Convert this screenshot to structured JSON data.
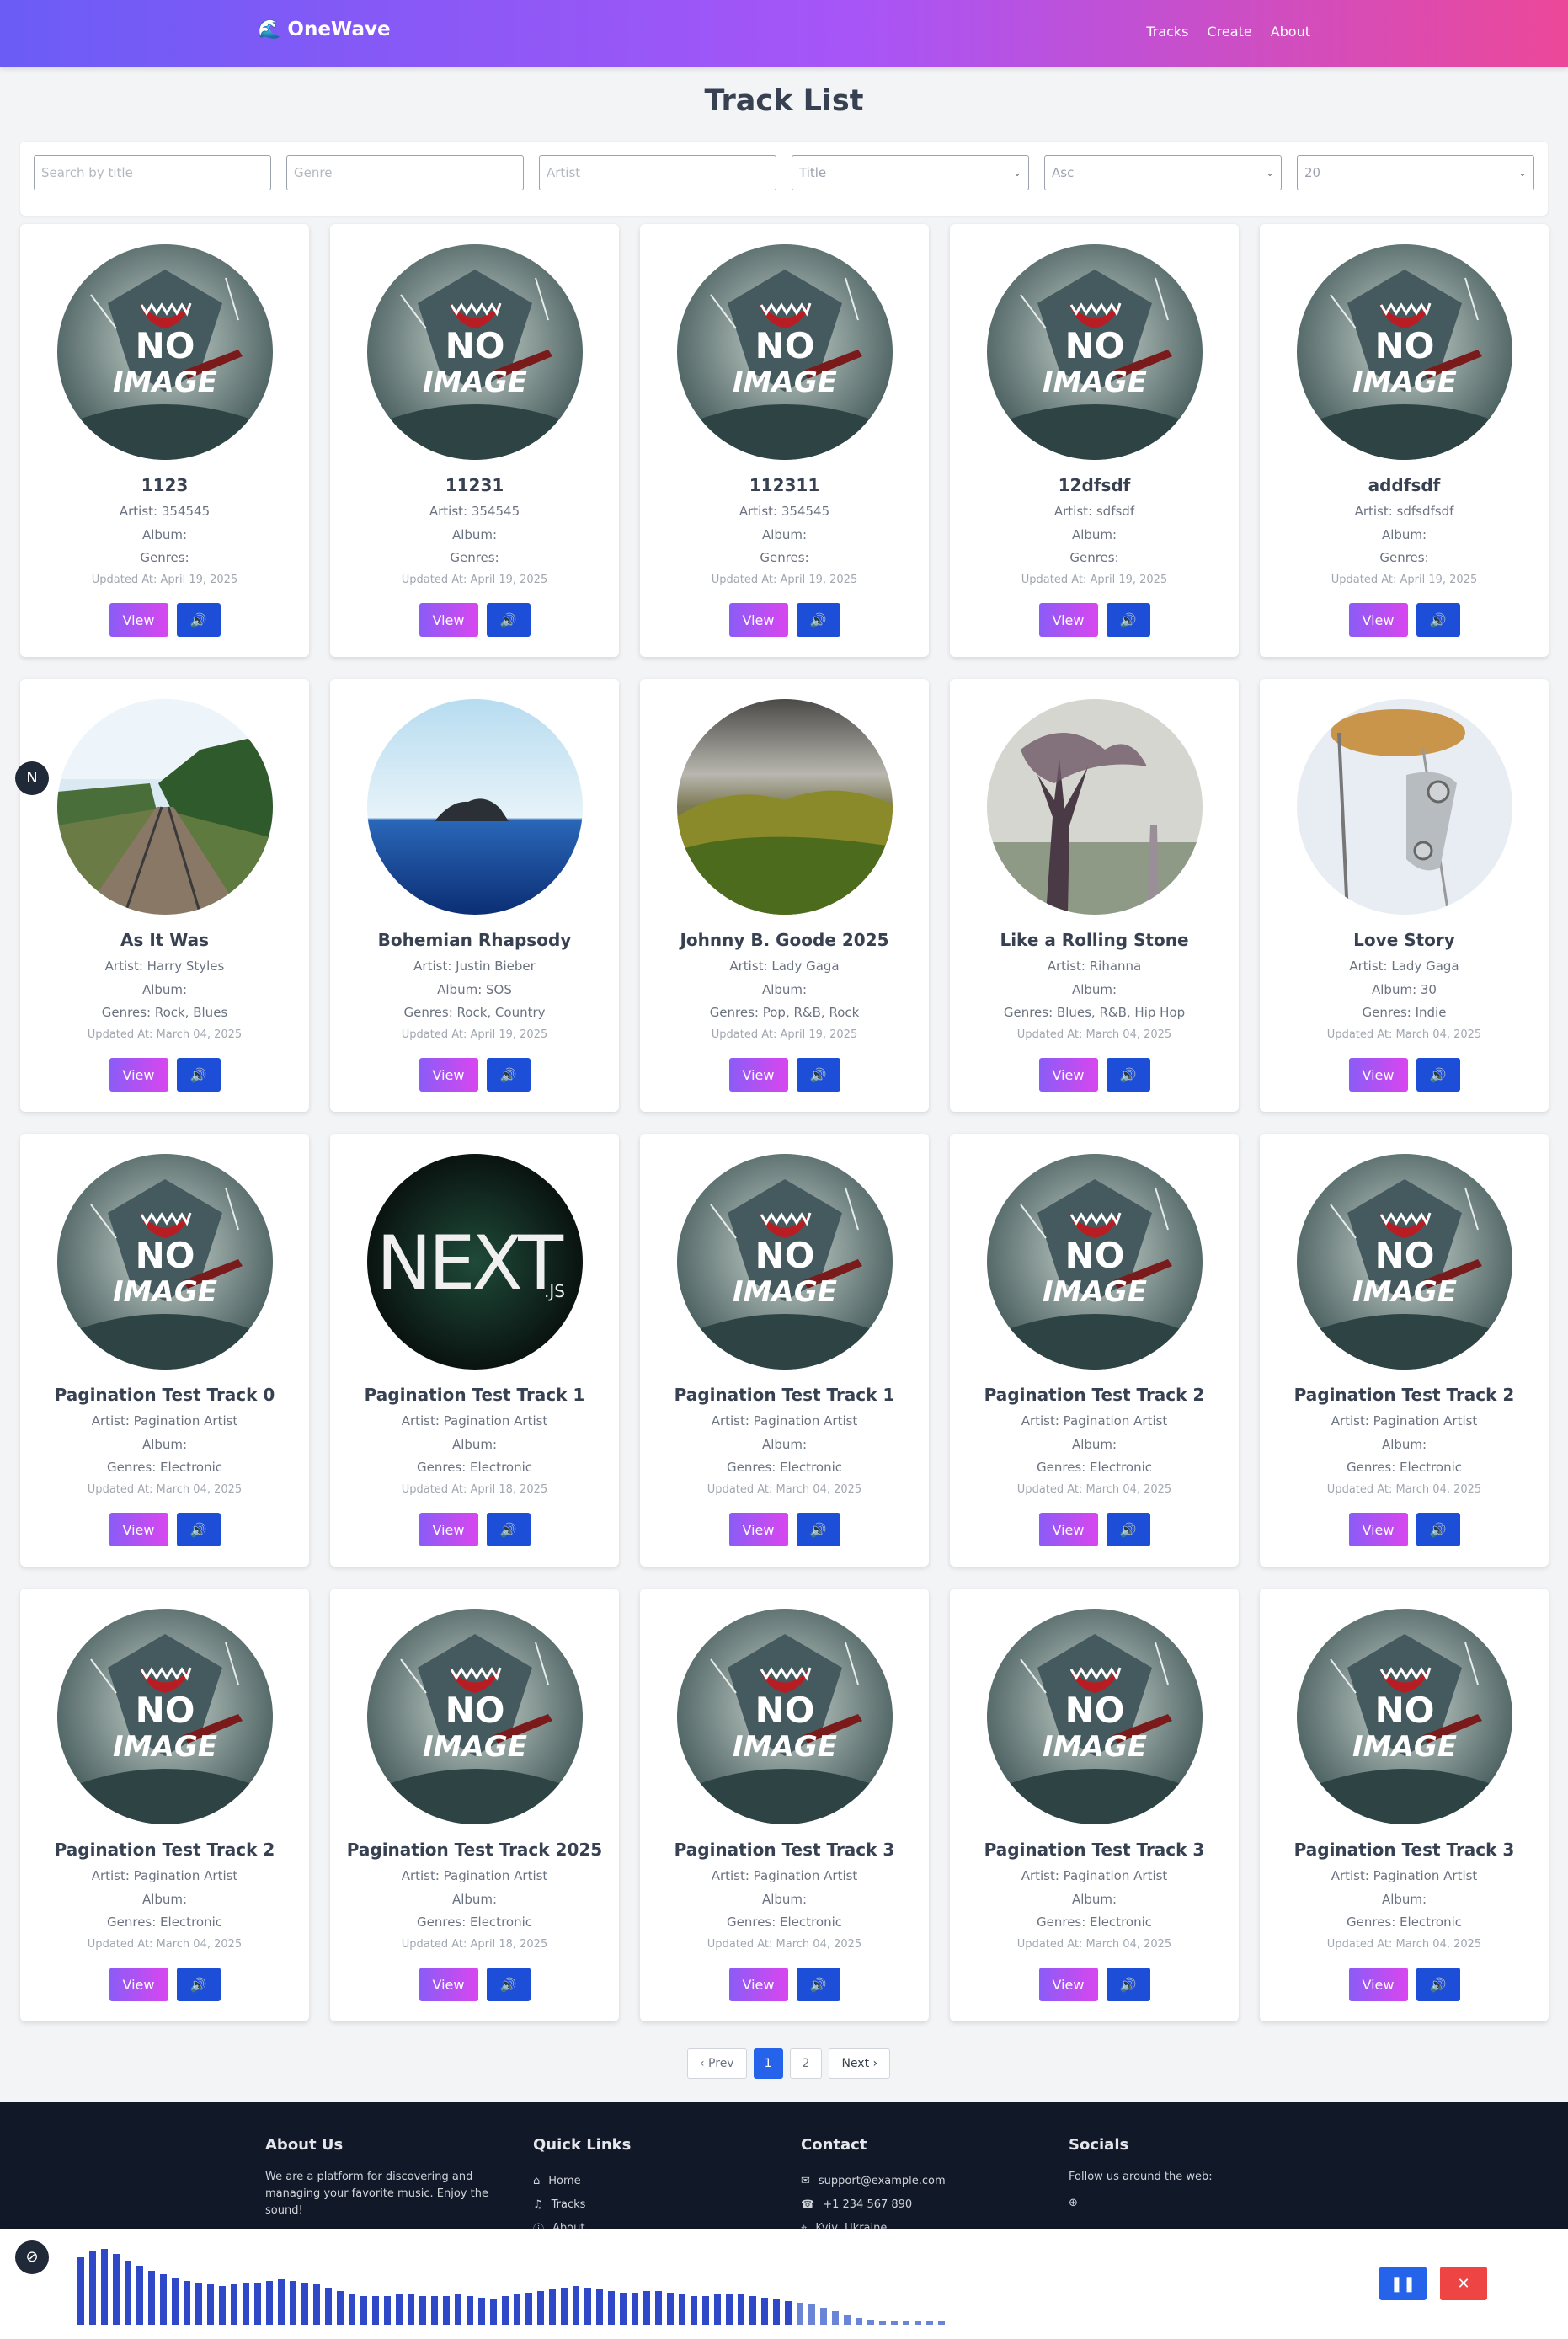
{
  "nav": {
    "brand": "OneWave",
    "links": [
      "Tracks",
      "Create",
      "About"
    ]
  },
  "page_title": "Track List",
  "filters": {
    "search_placeholder": "Search by title",
    "genre_placeholder": "Genre",
    "artist_placeholder": "Artist",
    "sort_value": "Title",
    "order_value": "Asc",
    "limit_value": "20"
  },
  "buttons": {
    "view": "View",
    "play_icon": "🔊"
  },
  "tracks": [
    {
      "title": "1123",
      "artist": "Artist: 354545",
      "album": "Album:",
      "genres": "Genres:",
      "updated": "Updated At: April 19, 2025",
      "cover": "no-image"
    },
    {
      "title": "11231",
      "artist": "Artist: 354545",
      "album": "Album:",
      "genres": "Genres:",
      "updated": "Updated At: April 19, 2025",
      "cover": "no-image"
    },
    {
      "title": "112311",
      "artist": "Artist: 354545",
      "album": "Album:",
      "genres": "Genres:",
      "updated": "Updated At: April 19, 2025",
      "cover": "no-image"
    },
    {
      "title": "12dfsdf",
      "artist": "Artist: sdfsdf",
      "album": "Album:",
      "genres": "Genres:",
      "updated": "Updated At: April 19, 2025",
      "cover": "no-image"
    },
    {
      "title": "addfsdf",
      "artist": "Artist: sdfsdfsdf",
      "album": "Album:",
      "genres": "Genres:",
      "updated": "Updated At: April 19, 2025",
      "cover": "no-image"
    },
    {
      "title": "As It Was",
      "artist": "Artist: Harry Styles",
      "album": "Album:",
      "genres": "Genres: Rock, Blues",
      "updated": "Updated At: March 04, 2025",
      "cover": "railway"
    },
    {
      "title": "Bohemian Rhapsody",
      "artist": "Artist: Justin Bieber",
      "album": "Album: SOS",
      "genres": "Genres: Rock, Country",
      "updated": "Updated At: April 19, 2025",
      "cover": "sea"
    },
    {
      "title": "Johnny B. Goode 2025",
      "artist": "Artist: Lady Gaga",
      "album": "Album:",
      "genres": "Genres: Pop, R&B, Rock",
      "updated": "Updated At: April 19, 2025",
      "cover": "hills"
    },
    {
      "title": "Like a Rolling Stone",
      "artist": "Artist: Rihanna",
      "album": "Album:",
      "genres": "Genres: Blues, R&B, Hip Hop",
      "updated": "Updated At: March 04, 2025",
      "cover": "fog-tree"
    },
    {
      "title": "Love Story",
      "artist": "Artist: Lady Gaga",
      "album": "Album: 30",
      "genres": "Genres: Indie",
      "updated": "Updated At: March 04, 2025",
      "cover": "drum"
    },
    {
      "title": "Pagination Test Track 0",
      "artist": "Artist: Pagination Artist",
      "album": "Album:",
      "genres": "Genres: Electronic",
      "updated": "Updated At: March 04, 2025",
      "cover": "no-image"
    },
    {
      "title": "Pagination Test Track 1",
      "artist": "Artist: Pagination Artist",
      "album": "Album:",
      "genres": "Genres: Electronic",
      "updated": "Updated At: April 18, 2025",
      "cover": "next"
    },
    {
      "title": "Pagination Test Track 1",
      "artist": "Artist: Pagination Artist",
      "album": "Album:",
      "genres": "Genres: Electronic",
      "updated": "Updated At: March 04, 2025",
      "cover": "no-image"
    },
    {
      "title": "Pagination Test Track 2",
      "artist": "Artist: Pagination Artist",
      "album": "Album:",
      "genres": "Genres: Electronic",
      "updated": "Updated At: March 04, 2025",
      "cover": "no-image"
    },
    {
      "title": "Pagination Test Track 2",
      "artist": "Artist: Pagination Artist",
      "album": "Album:",
      "genres": "Genres: Electronic",
      "updated": "Updated At: March 04, 2025",
      "cover": "no-image"
    },
    {
      "title": "Pagination Test Track 2",
      "artist": "Artist: Pagination Artist",
      "album": "Album:",
      "genres": "Genres: Electronic",
      "updated": "Updated At: March 04, 2025",
      "cover": "no-image"
    },
    {
      "title": "Pagination Test Track 2025",
      "artist": "Artist: Pagination Artist",
      "album": "Album:",
      "genres": "Genres: Electronic",
      "updated": "Updated At: April 18, 2025",
      "cover": "no-image"
    },
    {
      "title": "Pagination Test Track 3",
      "artist": "Artist: Pagination Artist",
      "album": "Album:",
      "genres": "Genres: Electronic",
      "updated": "Updated At: March 04, 2025",
      "cover": "no-image"
    },
    {
      "title": "Pagination Test Track 3",
      "artist": "Artist: Pagination Artist",
      "album": "Album:",
      "genres": "Genres: Electronic",
      "updated": "Updated At: March 04, 2025",
      "cover": "no-image"
    },
    {
      "title": "Pagination Test Track 3",
      "artist": "Artist: Pagination Artist",
      "album": "Album:",
      "genres": "Genres: Electronic",
      "updated": "Updated At: March 04, 2025",
      "cover": "no-image"
    }
  ],
  "pagination": {
    "prev": "‹ Prev",
    "pages": [
      "1",
      "2"
    ],
    "current": "1",
    "next": "Next ›"
  },
  "footer": {
    "about_title": "About Us",
    "about_text": "We are a platform for discovering and managing your favorite music. Enjoy the sound!",
    "links_title": "Quick Links",
    "links": [
      "Home",
      "Tracks",
      "About"
    ],
    "contact_title": "Contact",
    "email": "support@example.com",
    "phone": "+1 234 567 890",
    "location": "Kyiv, Ukraine",
    "socials_title": "Socials",
    "socials_text": "Follow us around the web:"
  },
  "badge_letter": "N",
  "player": {
    "pause_icon": "❚❚",
    "stop_icon": "✕"
  },
  "colors": {
    "nav_start": "#6b5cf6",
    "nav_end": "#ec4899",
    "primary": "#2563eb",
    "danger": "#ef4444",
    "footer_bg": "#111827"
  }
}
